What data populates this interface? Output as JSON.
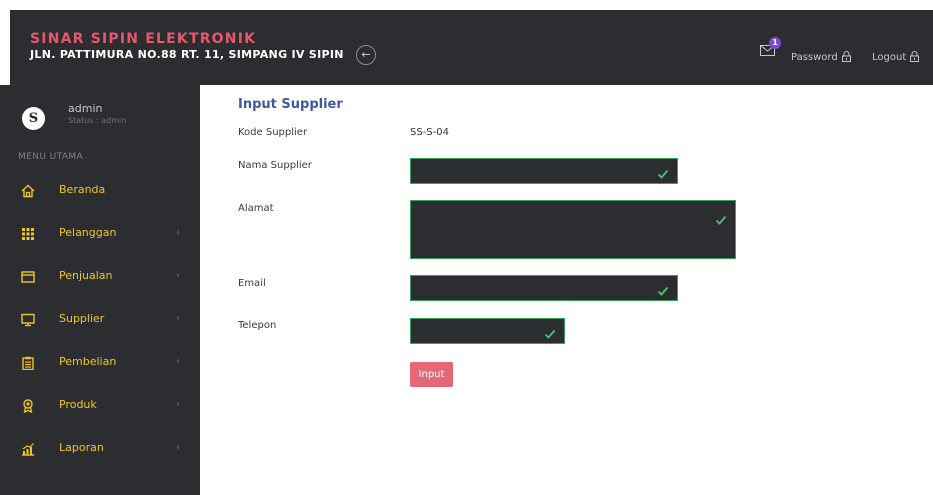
{
  "header": {
    "brand": "SINAR SIPIN ELEKTRONIK",
    "address": "JLN. PATTIMURA NO.88 RT. 11, SIMPANG IV SIPIN",
    "collapse_icon": "arrow-left-icon",
    "mail_badge": "1",
    "password_label": "Password",
    "logout_label": "Logout"
  },
  "sidebar": {
    "user_initial": "S",
    "user_name": "admin",
    "user_status": "Status : admin",
    "menu_heading": "MENU UTAMA",
    "items": [
      {
        "label": "Beranda",
        "icon": "home-icon",
        "chevron": ""
      },
      {
        "label": "Pelanggan",
        "icon": "grid-icon",
        "chevron": "‹"
      },
      {
        "label": "Penjualan",
        "icon": "window-icon",
        "chevron": "‹"
      },
      {
        "label": "Supplier",
        "icon": "monitor-icon",
        "chevron": "‹"
      },
      {
        "label": "Pembelian",
        "icon": "clipboard-icon",
        "chevron": "‹"
      },
      {
        "label": "Produk",
        "icon": "award-icon",
        "chevron": "‹"
      },
      {
        "label": "Laporan",
        "icon": "chart-icon",
        "chevron": "‹"
      }
    ]
  },
  "form": {
    "title": "Input Supplier",
    "kode_label": "Kode Supplier",
    "kode_value": "SS-S-04",
    "nama_label": "Nama Supplier",
    "alamat_label": "Alamat",
    "email_label": "Email",
    "telepon_label": "Telepon",
    "submit_label": "Input"
  },
  "colors": {
    "dark": "#2b2d31",
    "brand": "#e8566b",
    "menu_text": "#f3c623",
    "title": "#3e5a9c",
    "valid": "#3b9e5a",
    "button": "#e46876"
  }
}
